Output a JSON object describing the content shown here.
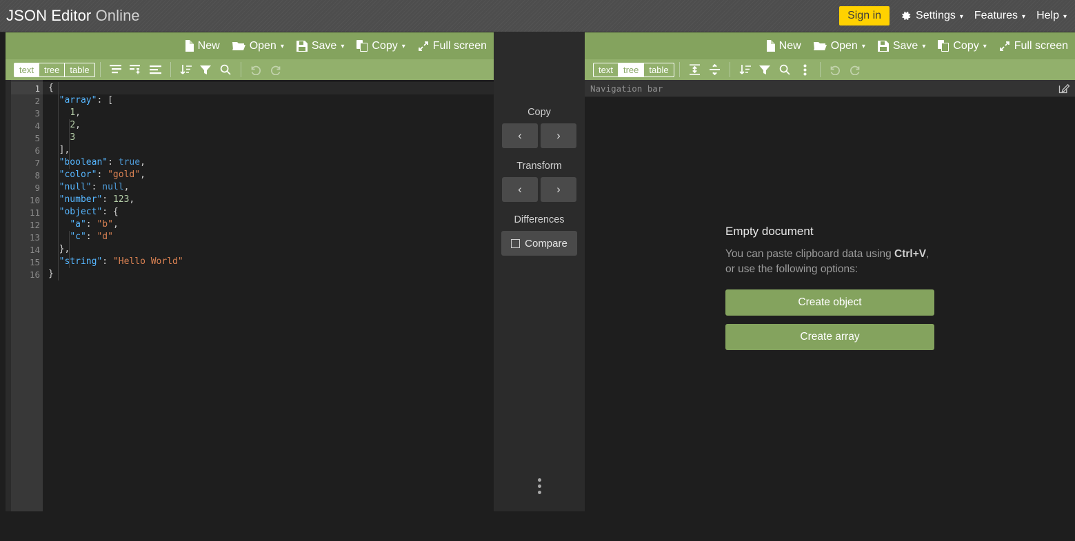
{
  "header": {
    "brand_main": "JSON Editor",
    "brand_light": "Online",
    "sign_in": "Sign in",
    "settings": "Settings",
    "features": "Features",
    "help": "Help",
    "caret": "▾",
    "accent_yellow": "#ffd200",
    "bar_color": "#4d4d4d"
  },
  "menu": {
    "new": "New",
    "open": "Open",
    "save": "Save",
    "copy": "Copy",
    "fullscreen": "Full screen",
    "caret": "▾",
    "green": "#84a35e"
  },
  "left_panel": {
    "modes": [
      {
        "label": "text",
        "active": true
      },
      {
        "label": "tree",
        "active": false
      },
      {
        "label": "table",
        "active": false
      }
    ],
    "code_lines": [
      {
        "n": "1",
        "fold": "∨",
        "active": true,
        "tokens": [
          {
            "t": "{",
            "c": "tok-punct"
          }
        ]
      },
      {
        "n": "2",
        "fold": "∨",
        "active": false,
        "tokens": [
          {
            "t": "  ",
            "c": "tok-punct"
          },
          {
            "t": "\"array\"",
            "c": "tok-key"
          },
          {
            "t": ": [",
            "c": "tok-punct"
          }
        ]
      },
      {
        "n": "3",
        "fold": "",
        "active": false,
        "tokens": [
          {
            "t": "    ",
            "c": "tok-punct"
          },
          {
            "t": "1",
            "c": "tok-num"
          },
          {
            "t": ",",
            "c": "tok-punct"
          }
        ]
      },
      {
        "n": "4",
        "fold": "",
        "active": false,
        "tokens": [
          {
            "t": "    ",
            "c": "tok-punct"
          },
          {
            "t": "2",
            "c": "tok-num"
          },
          {
            "t": ",",
            "c": "tok-punct"
          }
        ]
      },
      {
        "n": "5",
        "fold": "",
        "active": false,
        "tokens": [
          {
            "t": "    ",
            "c": "tok-punct"
          },
          {
            "t": "3",
            "c": "tok-num"
          }
        ]
      },
      {
        "n": "6",
        "fold": "",
        "active": false,
        "tokens": [
          {
            "t": "  ],",
            "c": "tok-punct"
          }
        ]
      },
      {
        "n": "7",
        "fold": "",
        "active": false,
        "tokens": [
          {
            "t": "  ",
            "c": "tok-punct"
          },
          {
            "t": "\"boolean\"",
            "c": "tok-key"
          },
          {
            "t": ": ",
            "c": "tok-punct"
          },
          {
            "t": "true",
            "c": "tok-bool"
          },
          {
            "t": ",",
            "c": "tok-punct"
          }
        ]
      },
      {
        "n": "8",
        "fold": "",
        "active": false,
        "tokens": [
          {
            "t": "  ",
            "c": "tok-punct"
          },
          {
            "t": "\"color\"",
            "c": "tok-key"
          },
          {
            "t": ": ",
            "c": "tok-punct"
          },
          {
            "t": "\"gold\"",
            "c": "tok-str"
          },
          {
            "t": ",",
            "c": "tok-punct"
          }
        ]
      },
      {
        "n": "9",
        "fold": "",
        "active": false,
        "tokens": [
          {
            "t": "  ",
            "c": "tok-punct"
          },
          {
            "t": "\"null\"",
            "c": "tok-key"
          },
          {
            "t": ": ",
            "c": "tok-punct"
          },
          {
            "t": "null",
            "c": "tok-null"
          },
          {
            "t": ",",
            "c": "tok-punct"
          }
        ]
      },
      {
        "n": "10",
        "fold": "",
        "active": false,
        "tokens": [
          {
            "t": "  ",
            "c": "tok-punct"
          },
          {
            "t": "\"number\"",
            "c": "tok-key"
          },
          {
            "t": ": ",
            "c": "tok-punct"
          },
          {
            "t": "123",
            "c": "tok-num"
          },
          {
            "t": ",",
            "c": "tok-punct"
          }
        ]
      },
      {
        "n": "11",
        "fold": "∨",
        "active": false,
        "tokens": [
          {
            "t": "  ",
            "c": "tok-punct"
          },
          {
            "t": "\"object\"",
            "c": "tok-key"
          },
          {
            "t": ": {",
            "c": "tok-punct"
          }
        ]
      },
      {
        "n": "12",
        "fold": "",
        "active": false,
        "tokens": [
          {
            "t": "    ",
            "c": "tok-punct"
          },
          {
            "t": "\"a\"",
            "c": "tok-key"
          },
          {
            "t": ": ",
            "c": "tok-punct"
          },
          {
            "t": "\"b\"",
            "c": "tok-str"
          },
          {
            "t": ",",
            "c": "tok-punct"
          }
        ]
      },
      {
        "n": "13",
        "fold": "",
        "active": false,
        "tokens": [
          {
            "t": "    ",
            "c": "tok-punct"
          },
          {
            "t": "\"c\"",
            "c": "tok-key"
          },
          {
            "t": ": ",
            "c": "tok-punct"
          },
          {
            "t": "\"d\"",
            "c": "tok-str"
          }
        ]
      },
      {
        "n": "14",
        "fold": "",
        "active": false,
        "tokens": [
          {
            "t": "  },",
            "c": "tok-punct"
          }
        ]
      },
      {
        "n": "15",
        "fold": "",
        "active": false,
        "tokens": [
          {
            "t": "  ",
            "c": "tok-punct"
          },
          {
            "t": "\"string\"",
            "c": "tok-key"
          },
          {
            "t": ": ",
            "c": "tok-punct"
          },
          {
            "t": "\"Hello World\"",
            "c": "tok-str"
          }
        ]
      },
      {
        "n": "16",
        "fold": "",
        "active": false,
        "tokens": [
          {
            "t": "}",
            "c": "tok-punct"
          }
        ]
      }
    ]
  },
  "middle": {
    "copy_label": "Copy",
    "transform_label": "Transform",
    "differences_label": "Differences",
    "compare_label": "Compare",
    "arrow_left": "‹",
    "arrow_right": "›"
  },
  "right_panel": {
    "modes": [
      {
        "label": "text",
        "active": false
      },
      {
        "label": "tree",
        "active": true
      },
      {
        "label": "table",
        "active": false
      }
    ],
    "nav_bar_text": "Navigation bar",
    "empty_title": "Empty document",
    "empty_desc_1": "You can paste clipboard data using ",
    "empty_desc_shortcut": "Ctrl+V",
    "empty_desc_2": ", or use the following options:",
    "create_object": "Create object",
    "create_array": "Create array"
  }
}
